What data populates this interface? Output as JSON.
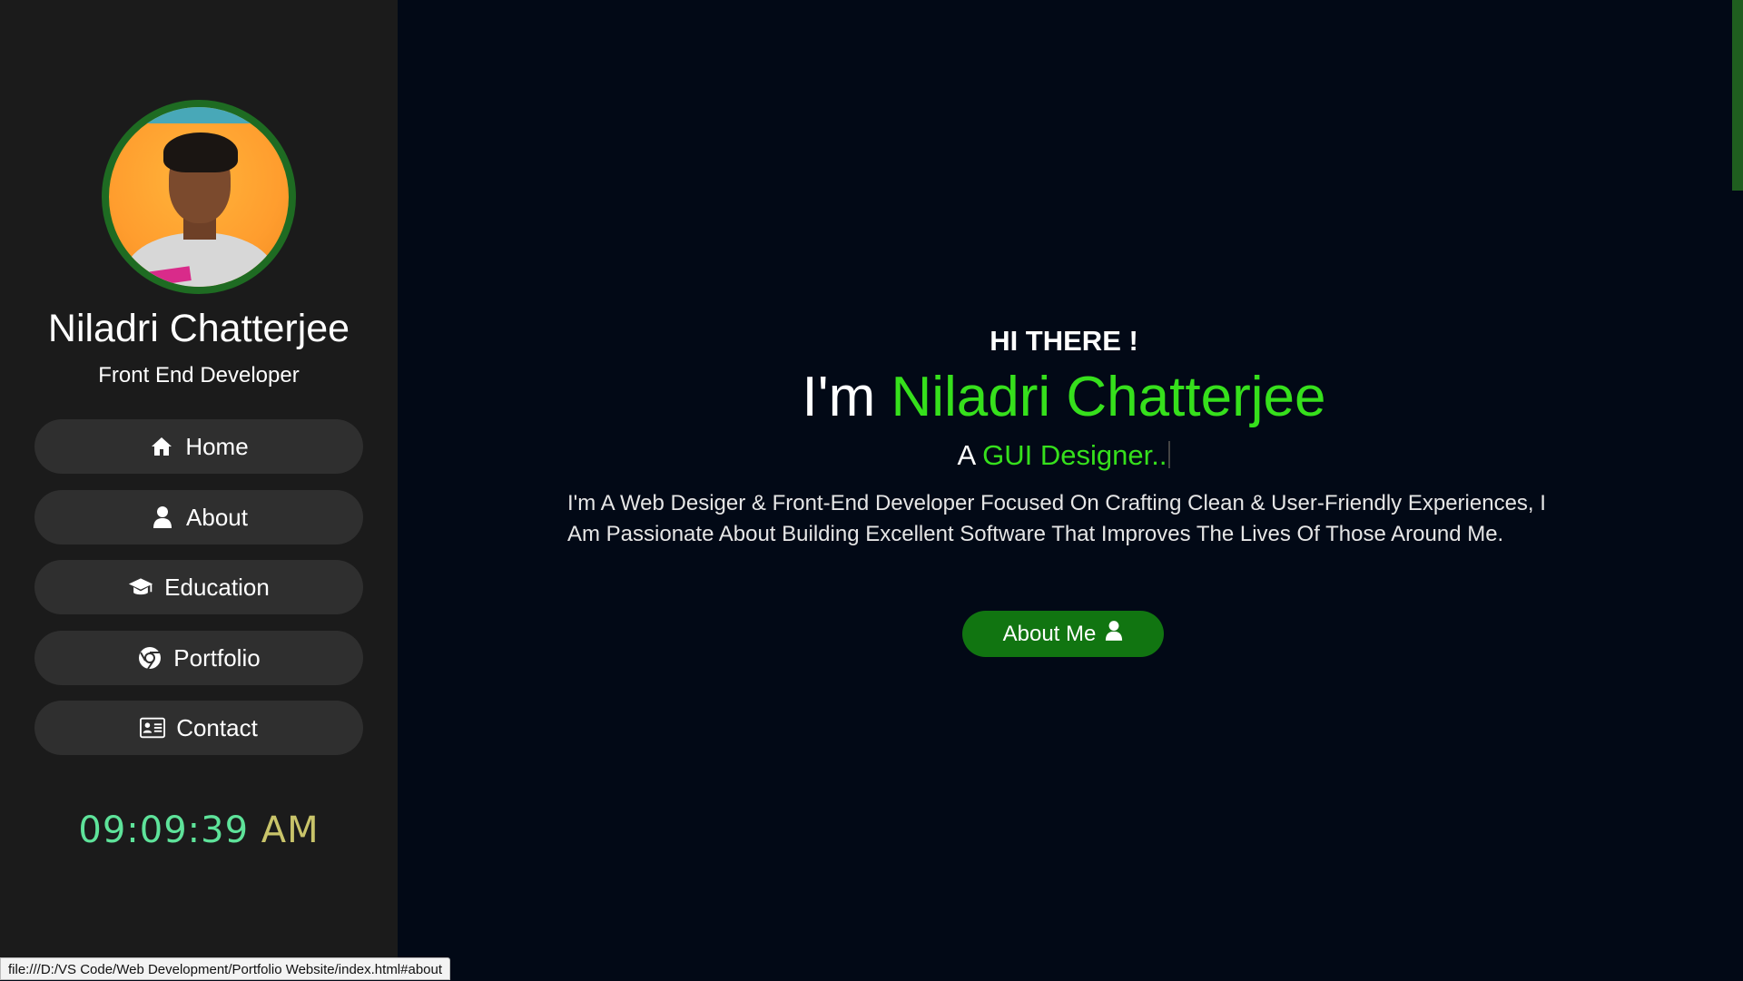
{
  "sidebar": {
    "profile_name": "Niladri Chatterjee",
    "profile_role": "Front End Developer",
    "nav": [
      {
        "label": "Home",
        "icon": "home-icon"
      },
      {
        "label": "About",
        "icon": "user-icon"
      },
      {
        "label": "Education",
        "icon": "graduation-cap-icon"
      },
      {
        "label": "Portfolio",
        "icon": "chrome-icon"
      },
      {
        "label": "Contact",
        "icon": "address-card-icon"
      }
    ],
    "clock": {
      "time": "09:09:39",
      "ampm": "AM"
    }
  },
  "hero": {
    "greeting": "HI THERE !",
    "im": "I'm",
    "name": "Niladri Chatterjee",
    "sub_prefix": "A",
    "typed_text": "GUI Designer..",
    "description": "I'm A Web Desiger & Front-End Developer Focused On Crafting Clean & User-Friendly Experiences, I Am Passionate About Building Excellent Software That Improves The Lives Of Those Around Me.",
    "cta_label": "About Me",
    "cta_icon": "user-icon"
  },
  "browser": {
    "status_url": "file:///D:/VS Code/Web Development/Portfolio Website/index.html#about"
  },
  "colors": {
    "accent_green": "#36e01c",
    "button_green": "#117511",
    "sidebar_bg": "#1b1b1b",
    "main_bg": "#020916"
  }
}
